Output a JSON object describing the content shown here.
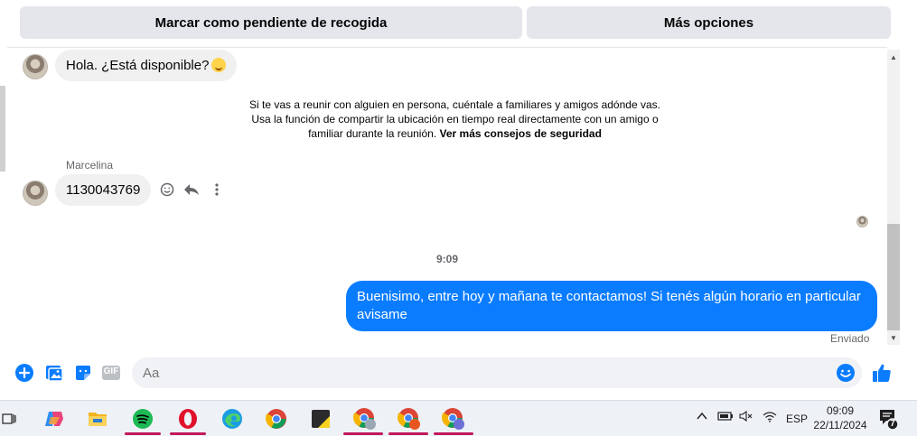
{
  "top_actions": {
    "pending_label": "Marcar como pendiente de recogida",
    "more_label": "Más opciones"
  },
  "messages": {
    "first_incoming": "Hola. ¿Está disponible?",
    "safety_text": "Si te vas a reunir con alguien en persona, cuéntale a familiares y amigos adónde vas. Usa la función de compartir la ubicación en tiempo real directamente con un amigo o familiar durante la reunión.",
    "safety_link": "Ver más consejos de seguridad",
    "sender_name": "Marcelina",
    "second_incoming": "1130043769",
    "time_separator": "9:09",
    "outgoing": "Buenisimo, entre hoy y mañana te contactamos! Si tenés algún horario en particular avisame",
    "status": "Enviado"
  },
  "composer": {
    "placeholder": "Aa",
    "gif_label": "GIF"
  },
  "taskbar": {
    "language": "ESP",
    "time": "09:09",
    "date": "22/11/2024",
    "notification_count": "7"
  },
  "colors": {
    "accent": "#0a7cff",
    "bubble_in": "#f0f0f0",
    "button_bg": "#e4e6eb"
  }
}
